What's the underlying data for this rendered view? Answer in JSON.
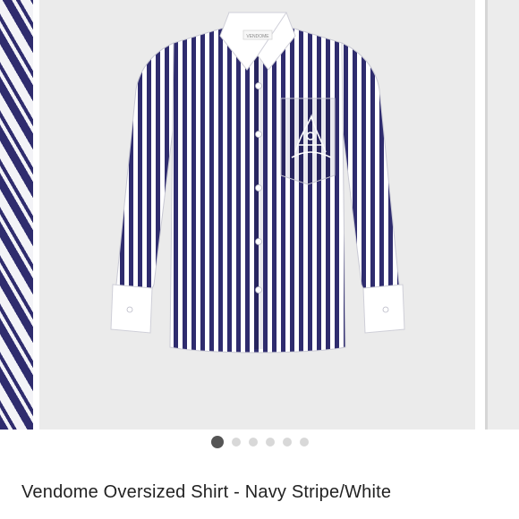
{
  "product": {
    "title": "Vendome Oversized Shirt - Navy Stripe/White",
    "label_text": "VENDOME"
  },
  "carousel": {
    "slide_count": 6,
    "active_index": 0
  },
  "colors": {
    "navy": "#2f2c6e",
    "white": "#ffffff",
    "background": "#ebebeb",
    "dot_active": "#555555",
    "dot_inactive": "#d8d8d8"
  }
}
